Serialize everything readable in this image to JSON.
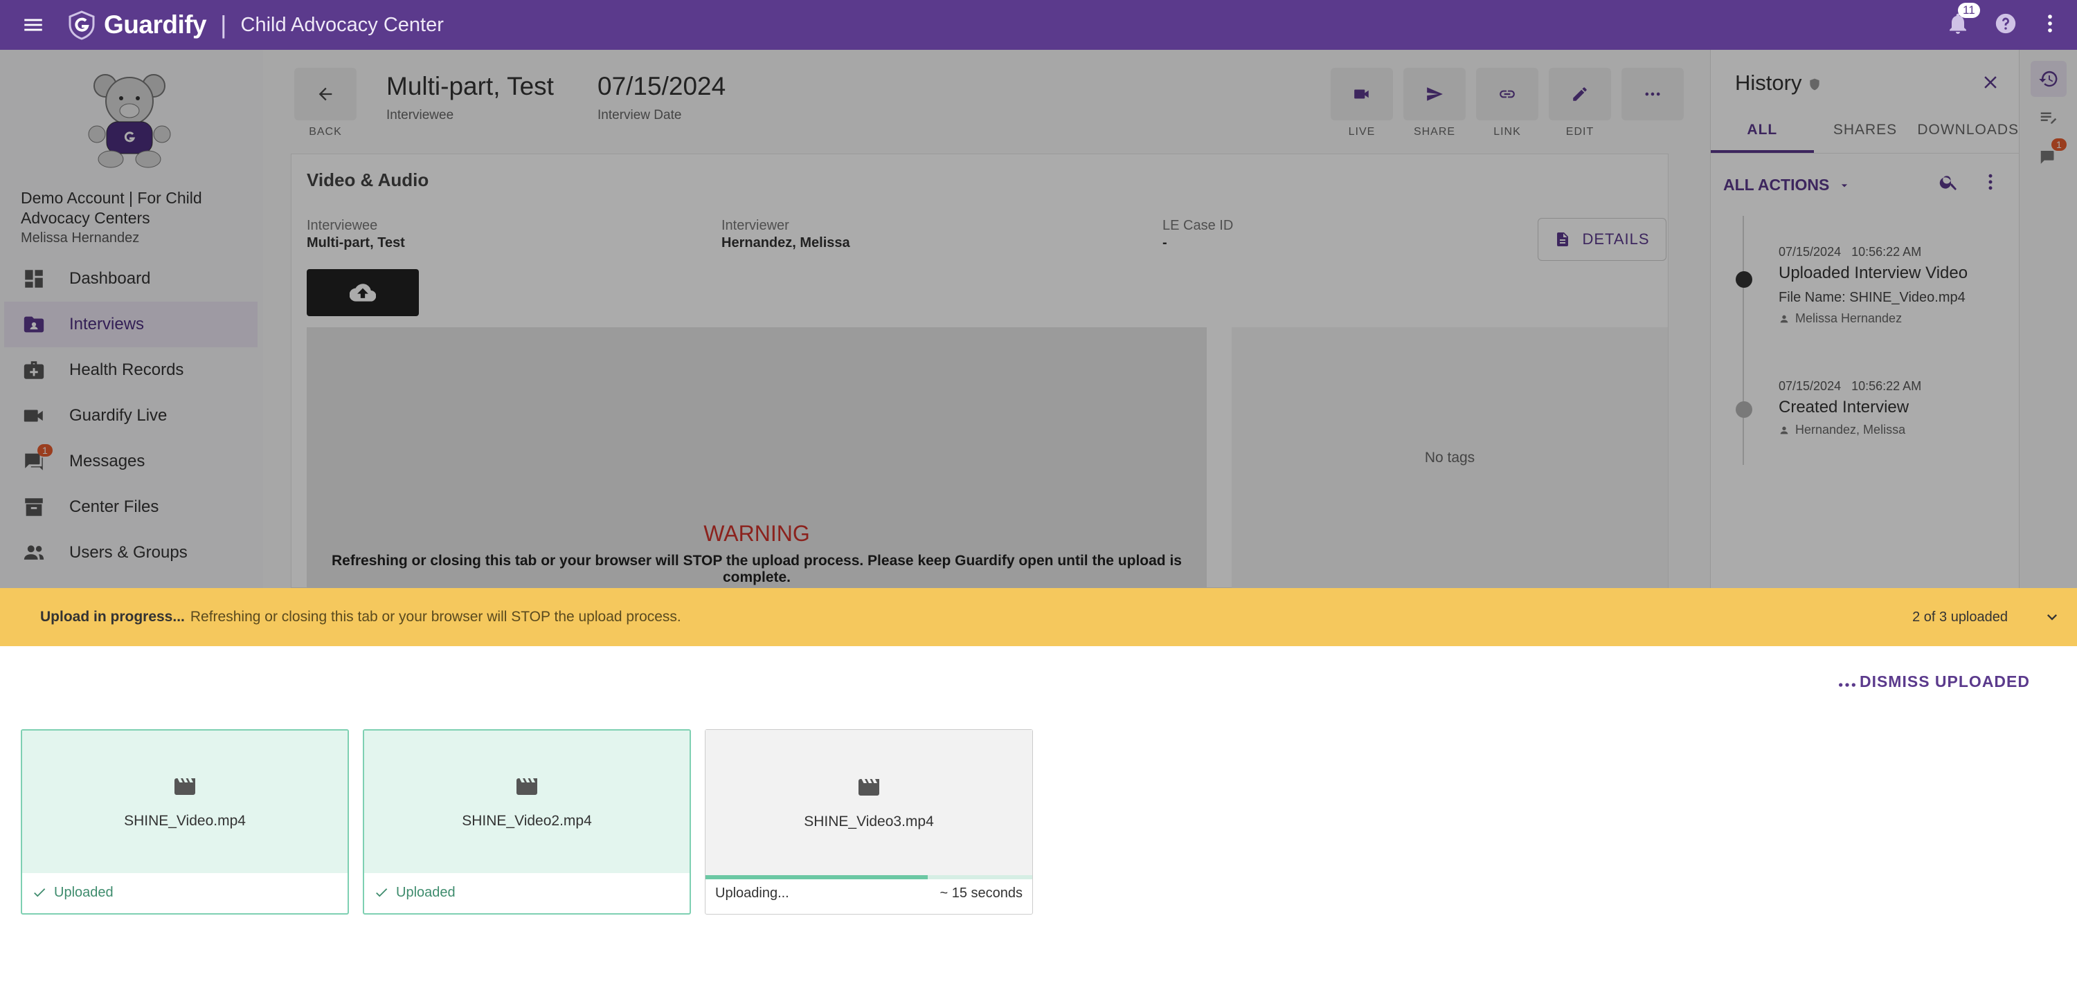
{
  "app": {
    "brand": "Guardify",
    "separator": "|",
    "org": "Child Advocacy Center",
    "notifications_count": "11"
  },
  "sidebar": {
    "account_name": "Demo Account | For Child Advocacy Centers",
    "user_name": "Melissa Hernandez",
    "items": [
      {
        "label": "Dashboard",
        "icon": "dashboard-icon"
      },
      {
        "label": "Interviews",
        "icon": "interview-folder-icon"
      },
      {
        "label": "Health Records",
        "icon": "medical-bag-icon"
      },
      {
        "label": "Guardify Live",
        "icon": "video-camera-icon"
      },
      {
        "label": "Messages",
        "icon": "chat-icon",
        "badge": "1"
      },
      {
        "label": "Center Files",
        "icon": "archive-icon"
      },
      {
        "label": "Users & Groups",
        "icon": "people-icon"
      }
    ]
  },
  "header": {
    "back_label": "BACK",
    "interviewee_name": "Multi-part, Test",
    "interviewee_label": "Interviewee",
    "interview_date": "07/15/2024",
    "interview_date_label": "Interview Date",
    "actions": [
      {
        "label": "LIVE",
        "icon": "video-camera-icon"
      },
      {
        "label": "SHARE",
        "icon": "send-icon"
      },
      {
        "label": "LINK",
        "icon": "link-icon"
      },
      {
        "label": "EDIT",
        "icon": "pencil-icon"
      }
    ]
  },
  "card": {
    "title": "Video & Audio",
    "interviewee_label": "Interviewee",
    "interviewee_value": "Multi-part, Test",
    "interviewer_label": "Interviewer",
    "interviewer_value": "Hernandez, Melissa",
    "case_label": "LE Case ID",
    "case_value": "-",
    "details_label": "DETAILS",
    "warning_title": "WARNING",
    "warning_text": "Refreshing or closing this tab or your browser will STOP the upload process. Please keep Guardify open until the upload is complete.",
    "tags_empty": "No tags"
  },
  "history": {
    "title": "History",
    "tabs": [
      "ALL",
      "SHARES",
      "DOWNLOADS"
    ],
    "filter_label": "ALL ACTIONS",
    "events": [
      {
        "date": "07/15/2024",
        "time": "10:56:22 AM",
        "title": "Uploaded Interview Video",
        "file": "File Name: SHINE_Video.mp4",
        "user": "Melissa Hernandez"
      },
      {
        "date": "07/15/2024",
        "time": "10:56:22 AM",
        "title": "Created Interview",
        "user": "Hernandez, Melissa"
      }
    ],
    "rail_badge": "1"
  },
  "upload": {
    "banner_lead": "Upload in progress...",
    "banner_text": "Refreshing or closing this tab or your browser will STOP the upload process.",
    "count_text": "2 of 3 uploaded",
    "dismiss_label": "DISMISS UPLOADED",
    "files": [
      {
        "name": "SHINE_Video.mp4",
        "status": "Uploaded"
      },
      {
        "name": "SHINE_Video2.mp4",
        "status": "Uploaded"
      },
      {
        "name": "SHINE_Video3.mp4",
        "status": "Uploading...",
        "eta": "~ 15 seconds",
        "progress": 0.68
      }
    ]
  },
  "colors": {
    "brand": "#5b3a8c",
    "banner": "#f5c85d",
    "success": "#3e8c6d",
    "warning": "#d0342c"
  }
}
